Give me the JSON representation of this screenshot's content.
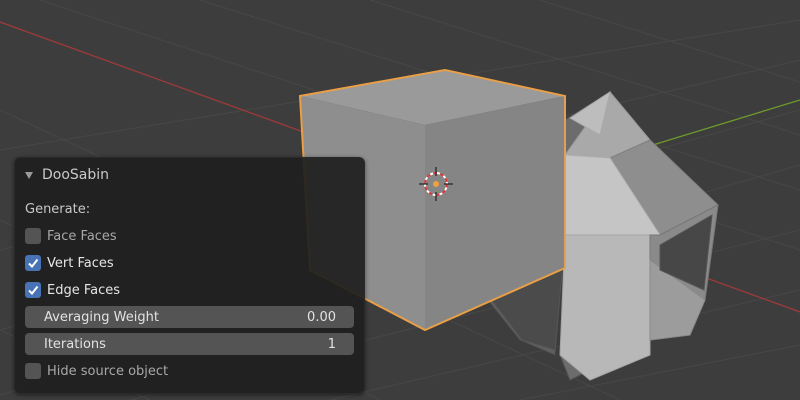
{
  "panel": {
    "title": "DooSabin",
    "generate_label": "Generate:",
    "options": [
      {
        "label": "Face Faces",
        "checked": false
      },
      {
        "label": "Vert Faces",
        "checked": true
      },
      {
        "label": "Edge Faces",
        "checked": true
      }
    ],
    "fields": [
      {
        "label": "Averaging Weight",
        "value": "0.00"
      },
      {
        "label": "Iterations",
        "value": "1"
      }
    ],
    "hide_source": {
      "label": "Hide source object",
      "checked": false
    }
  },
  "colors": {
    "viewport_bg": "#3d3d3d",
    "selection_outline": "#f0a040",
    "x_axis": "#b03838",
    "y_axis": "#6e9a2a",
    "checkbox_on": "#4772b3"
  }
}
